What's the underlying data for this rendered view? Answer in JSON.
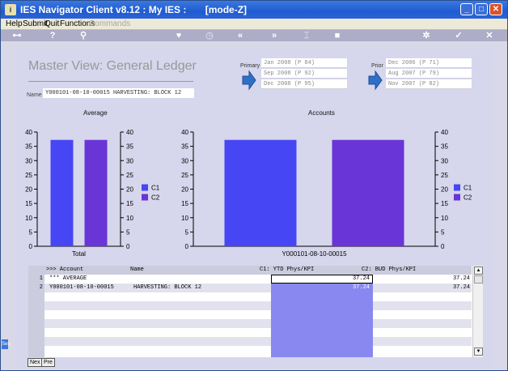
{
  "window": {
    "title": "IES Navigator Client v8.12 : My IES :       [mode-Z]",
    "controls": [
      "minimize",
      "maximize",
      "close"
    ]
  },
  "menu": {
    "items": [
      {
        "label": "Help",
        "enabled": true
      },
      {
        "label": "Submit",
        "enabled": true
      },
      {
        "label": "Quit",
        "enabled": true
      },
      {
        "label": "Functions",
        "enabled": true
      },
      {
        "label": "Commands",
        "enabled": false
      }
    ]
  },
  "toolbar": {
    "icons": [
      "key-icon",
      "help-icon",
      "search-icon",
      "heart-icon",
      "clock-icon",
      "rewind-icon",
      "fast-forward-icon",
      "bracket-icon",
      "stop-icon",
      "gear-icon",
      "check-icon",
      "close-icon"
    ]
  },
  "view": {
    "title": "Master View: General Ledger",
    "name_label": "Name",
    "name_value": "Y000101-08-10-00015 HARVESTING: BLOCK 12",
    "primary_label": "Primary",
    "primary_periods": [
      "Jan 2008 (P 84)",
      "Sep 2008 (P 92)",
      "Dec 2008 (P 95)"
    ],
    "prior_label": "Prior",
    "prior_periods": [
      "Dec 2006 (P 71)",
      "Aug 2007 (P 79)",
      "Nov 2007 (P 82)"
    ]
  },
  "chart_data": [
    {
      "type": "bar",
      "title": "Average",
      "categories": [
        "Total"
      ],
      "series": [
        {
          "name": "C1",
          "values": [
            37.24
          ],
          "color": "#4646f5"
        },
        {
          "name": "C2",
          "values": [
            37.24
          ],
          "color": "#6a35d6"
        }
      ],
      "ylim": [
        0,
        40
      ],
      "yticks": [
        0,
        5,
        10,
        15,
        20,
        25,
        30,
        35,
        40
      ],
      "legend": "right",
      "grid": false
    },
    {
      "type": "bar",
      "title": "Accounts",
      "categories": [
        "Y000101-08-10-00015"
      ],
      "series": [
        {
          "name": "C1",
          "values": [
            37.24
          ],
          "color": "#4646f5"
        },
        {
          "name": "C2",
          "values": [
            37.24
          ],
          "color": "#6a35d6"
        }
      ],
      "ylim": [
        0,
        40
      ],
      "yticks": [
        0,
        5,
        10,
        15,
        20,
        25,
        30,
        35,
        40
      ],
      "legend": "right",
      "grid": false
    }
  ],
  "grid": {
    "headers": {
      "account": ">>> Account",
      "name": "Name",
      "c1": "C1: YTD Phys/KPI",
      "c2": "C2: BUD Phys/KPI"
    },
    "rows": [
      {
        "num": "1",
        "account": "*** AVERAGE",
        "name": "",
        "c1": "37.24",
        "c2": "37.24"
      },
      {
        "num": "2",
        "account": "Y000101-08-10-00015",
        "name": "HARVESTING: BLOCK 12",
        "c1": "37.24",
        "c2": "37.24"
      }
    ]
  },
  "bottom_tabs": [
    "Nex",
    "Pre"
  ],
  "edge_label": "Ses"
}
